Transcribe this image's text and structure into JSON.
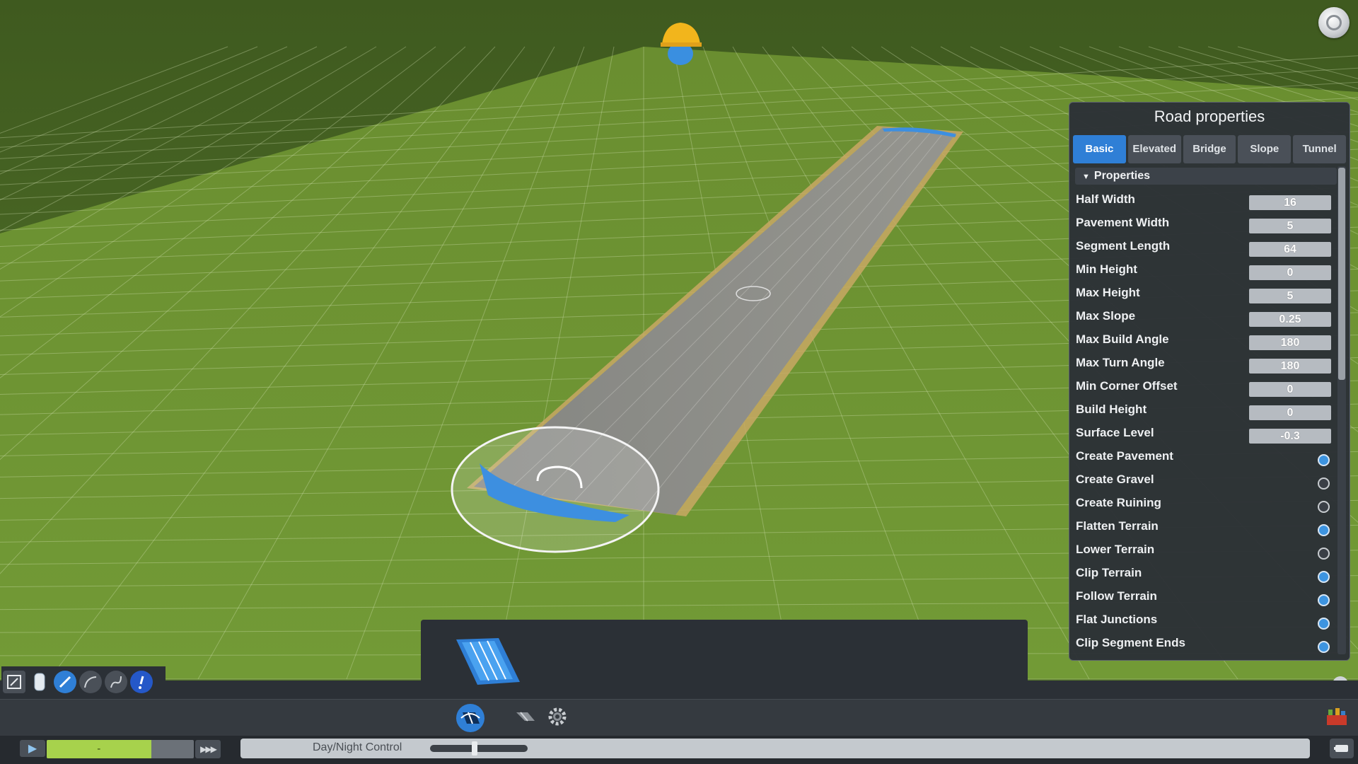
{
  "panel": {
    "title": "Road properties",
    "tabs": [
      {
        "label": "Basic",
        "active": true
      },
      {
        "label": "Elevated",
        "active": false
      },
      {
        "label": "Bridge",
        "active": false
      },
      {
        "label": "Slope",
        "active": false
      },
      {
        "label": "Tunnel",
        "active": false
      }
    ],
    "section_label": "Properties",
    "fields": [
      {
        "label": "Half Width",
        "value": "16"
      },
      {
        "label": "Pavement Width",
        "value": "5"
      },
      {
        "label": "Segment Length",
        "value": "64"
      },
      {
        "label": "Min Height",
        "value": "0"
      },
      {
        "label": "Max Height",
        "value": "5"
      },
      {
        "label": "Max Slope",
        "value": "0.25"
      },
      {
        "label": "Max Build Angle",
        "value": "180"
      },
      {
        "label": "Max Turn Angle",
        "value": "180"
      },
      {
        "label": "Min Corner Offset",
        "value": "0"
      },
      {
        "label": "Build Height",
        "value": "0"
      },
      {
        "label": "Surface Level",
        "value": "-0.3"
      }
    ],
    "toggles": [
      {
        "label": "Create Pavement",
        "on": true
      },
      {
        "label": "Create Gravel",
        "on": false
      },
      {
        "label": "Create Ruining",
        "on": false
      },
      {
        "label": "Flatten Terrain",
        "on": true
      },
      {
        "label": "Lower Terrain",
        "on": false
      },
      {
        "label": "Clip Terrain",
        "on": true
      },
      {
        "label": "Follow Terrain",
        "on": true
      },
      {
        "label": "Flat Junctions",
        "on": true
      },
      {
        "label": "Clip Segment Ends",
        "on": true
      }
    ]
  },
  "status_bar": {
    "speed_label": "-",
    "speed_level": 0.71,
    "day_night_label": "Day/Night Control",
    "day_night_level": 0.46
  },
  "colors": {
    "accent": "#2f7fd6",
    "grass": "#6e9a35",
    "road": "#8a8a86",
    "selection": "#3d8fe0"
  },
  "icons": {
    "corner": "settings-circle-icon",
    "tools": [
      "edit-icon",
      "cylinder-icon",
      "pencil-icon",
      "curve-icon",
      "freeform-icon",
      "exclamation-icon"
    ],
    "bottom": [
      "road-tool-icon",
      "road-category-icon",
      "gear-icon"
    ],
    "close": "close-icon",
    "right_status": "chirper-icon",
    "corner_bottom_right": "toolbox-icon"
  }
}
